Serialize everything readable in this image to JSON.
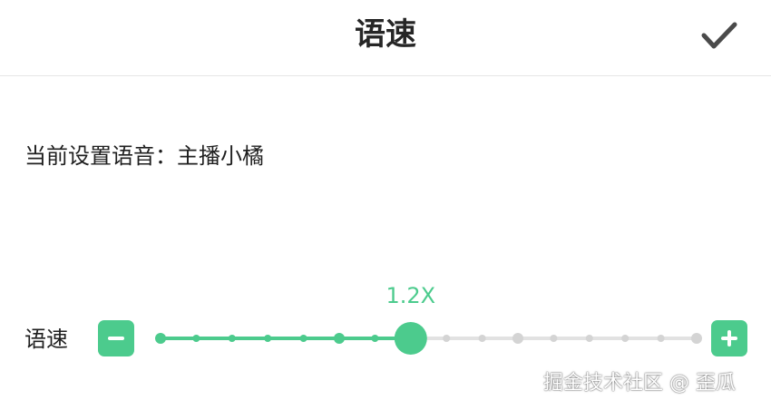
{
  "header": {
    "title": "语速",
    "confirm_icon": "checkmark-icon"
  },
  "voice": {
    "current_voice_text": "当前设置语音：主播小橘"
  },
  "speed": {
    "label": "语速",
    "value_text": "1.2X",
    "selected_step": 7,
    "step_count": 16,
    "major_steps": [
      0,
      5,
      10,
      15
    ],
    "decrease_icon": "minus-icon",
    "increase_icon": "plus-icon"
  },
  "colors": {
    "accent": "#4ccb8d",
    "track_inactive": "#e2e2e2",
    "dot_inactive": "#d4d4d4"
  },
  "watermark": {
    "text": "掘金技术社区 @ 歪瓜"
  }
}
